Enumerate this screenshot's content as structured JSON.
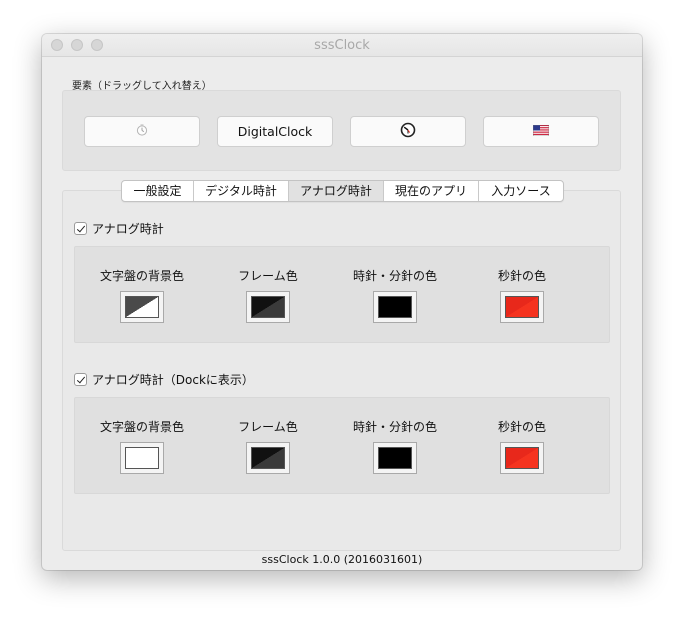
{
  "window": {
    "title": "sssClock"
  },
  "elements_section": {
    "label": "要素（ドラッグして入れ替え）",
    "items": [
      {
        "kind": "icon",
        "icon": "small-clock-icon"
      },
      {
        "kind": "text",
        "label": "DigitalClock"
      },
      {
        "kind": "icon",
        "icon": "analog-clock-icon"
      },
      {
        "kind": "icon",
        "icon": "us-flag-icon"
      }
    ]
  },
  "tabs": {
    "items": [
      {
        "label": "一般設定",
        "selected": false
      },
      {
        "label": "デジタル時計",
        "selected": false
      },
      {
        "label": "アナログ時計",
        "selected": true
      },
      {
        "label": "現在のアプリ",
        "selected": false
      },
      {
        "label": "入力ソース",
        "selected": false
      }
    ]
  },
  "analog_clock": {
    "checkbox_label": "アナログ時計",
    "checked": true,
    "colors": [
      {
        "label": "文字盤の背景色",
        "swatch": "split",
        "colors": [
          "#4a4a4a",
          "#ffffff"
        ]
      },
      {
        "label": "フレーム色",
        "swatch": "split",
        "colors": [
          "#111111",
          "#3a3a3a"
        ]
      },
      {
        "label": "時針・分針の色",
        "swatch": "solid",
        "colors": [
          "#000000"
        ]
      },
      {
        "label": "秒針の色",
        "swatch": "split",
        "colors": [
          "#e8281b",
          "#f5331f"
        ]
      }
    ]
  },
  "analog_clock_dock": {
    "checkbox_label": "アナログ時計（Dockに表示）",
    "checked": true,
    "colors": [
      {
        "label": "文字盤の背景色",
        "swatch": "solid",
        "colors": [
          "#ffffff"
        ]
      },
      {
        "label": "フレーム色",
        "swatch": "split",
        "colors": [
          "#111111",
          "#3a3a3a"
        ]
      },
      {
        "label": "時針・分針の色",
        "swatch": "solid",
        "colors": [
          "#000000"
        ]
      },
      {
        "label": "秒針の色",
        "swatch": "split",
        "colors": [
          "#e8281b",
          "#f5331f"
        ]
      }
    ]
  },
  "footer": {
    "version": "sssClock 1.0.0 (2016031601)"
  }
}
